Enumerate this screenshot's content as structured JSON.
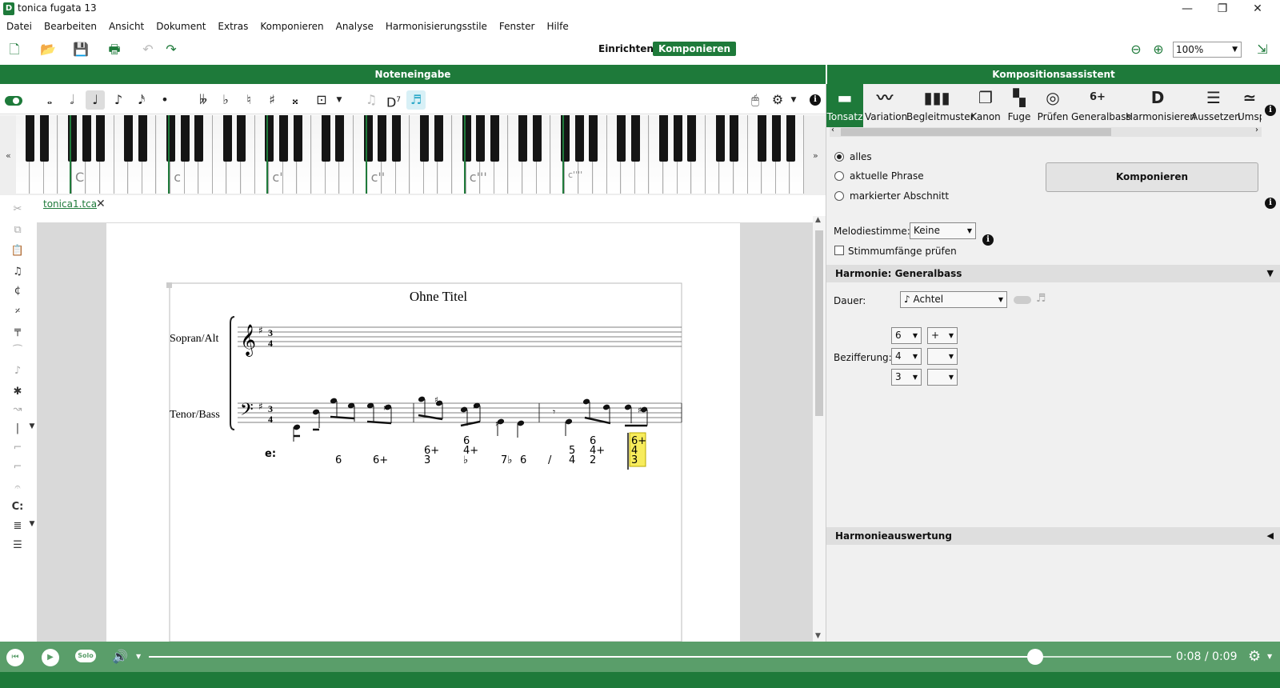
{
  "window": {
    "title": "tonica fugata 13",
    "app_icon": "D"
  },
  "menu": [
    "Datei",
    "Bearbeiten",
    "Ansicht",
    "Dokument",
    "Extras",
    "Komponieren",
    "Analyse",
    "Harmonisierungsstile",
    "Fenster",
    "Hilfe"
  ],
  "toolbar": {
    "mode_setup": "Einrichten",
    "mode_compose": "Komponieren",
    "zoom": "100%"
  },
  "panels": {
    "left_title": "Noteneingabe",
    "right_title": "Kompositionsassistent"
  },
  "note_toolbar": {
    "chord_label": "D",
    "chord_superscript": "7",
    "items": [
      "toggle",
      "whole-note",
      "half-note",
      "quarter-note",
      "eighth-note",
      "sixteenth-note",
      "dot",
      "double-flat",
      "flat",
      "natural",
      "sharp",
      "double-sharp",
      "tie",
      "d7",
      "fifth",
      "mouse",
      "gear",
      "info"
    ]
  },
  "keyboard": {
    "labels": [
      "C",
      "c",
      "c'",
      "c''",
      "c'''",
      "c''''"
    ],
    "scroll_left": "«",
    "scroll_right": "»"
  },
  "document": {
    "tab": "tonica1.tca",
    "score": {
      "title": "Ohne Titel",
      "staff1": "Sopran/Alt",
      "staff2": "Tenor/Bass",
      "time_sig": [
        "3",
        "4"
      ],
      "key_label": "e:",
      "figures": [
        {
          "lines": [
            "6"
          ]
        },
        {
          "lines": [
            "6+"
          ]
        },
        {
          "lines": [
            "6+",
            "3"
          ]
        },
        {
          "lines": [
            "6",
            "4+",
            "♭"
          ]
        },
        {
          "lines": [
            "7♭"
          ]
        },
        {
          "lines": [
            "6"
          ]
        },
        {
          "lines": [
            "/"
          ]
        },
        {
          "lines": [
            "5",
            "4"
          ]
        },
        {
          "lines": [
            "6",
            "4+",
            "2"
          ]
        },
        {
          "lines": [
            "6+",
            "4",
            "3"
          ],
          "highlight": true
        }
      ]
    }
  },
  "assistant": {
    "tabs": [
      "Tonsatz",
      "Variation",
      "Begleitmuster",
      "Kanon",
      "Fuge",
      "Prüfen",
      "Generalbass",
      "Harmonisieren",
      "Aussetzen",
      "Umsp"
    ],
    "selected_tab": "Tonsatz",
    "generalbass_icon": "6+",
    "harmonisieren_icon": "D",
    "scope": [
      "alles",
      "aktuelle Phrase",
      "markierter Abschnitt"
    ],
    "compose_button": "Komponieren",
    "melody_label": "Melodiestimme:",
    "melody_value": "Keine",
    "check_ranges": "Stimmumfänge prüfen",
    "section_harmony": "Harmonie: Generalbass",
    "duration_label": "Dauer:",
    "duration_value": "Achtel",
    "duration_note": "♪",
    "figuring_label": "Bezifferung:",
    "figuring": [
      [
        "6",
        "+"
      ],
      [
        "4",
        ""
      ],
      [
        "3",
        ""
      ]
    ],
    "section_eval": "Harmonieauswertung"
  },
  "player": {
    "solo": "Solo",
    "time": "0:08 / 0:09",
    "progress": 0.867
  },
  "colors": {
    "accent": "#1e7a3a",
    "player": "#5a9e6a",
    "highlight": "#f7ec5c"
  }
}
